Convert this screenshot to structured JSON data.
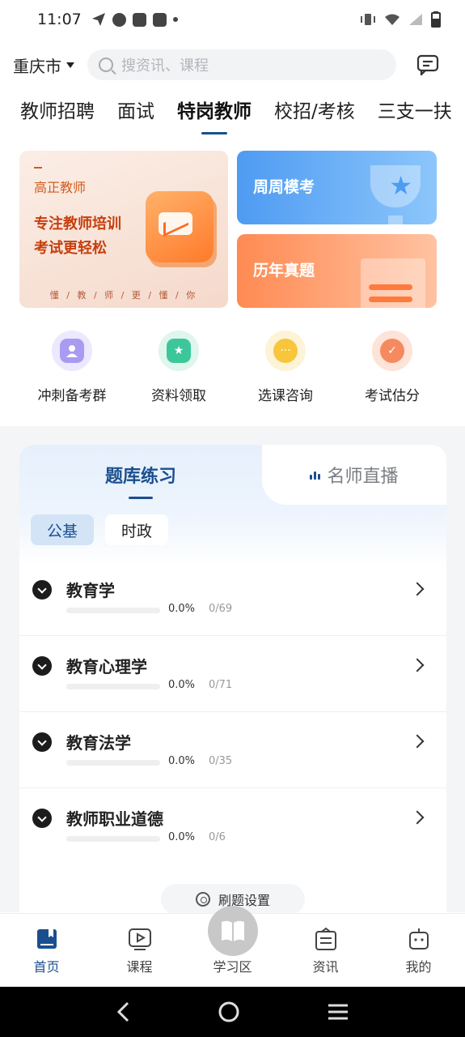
{
  "status_bar": {
    "time": "11:07"
  },
  "header": {
    "city": "重庆市",
    "search_placeholder": "搜资讯、课程"
  },
  "categories": [
    {
      "label": "教师招聘"
    },
    {
      "label": "面试"
    },
    {
      "label": "特岗教师"
    },
    {
      "label": "校招/考核"
    },
    {
      "label": "三支一扶"
    }
  ],
  "banners": {
    "main": {
      "brand": "高正教师",
      "line1": "专注教师培训",
      "line2": "考试更轻松",
      "tagline": "懂 / 教 / 师 / 更 / 懂 / 你"
    },
    "weekly": {
      "title": "周周模考"
    },
    "past": {
      "title": "历年真题"
    }
  },
  "quick_actions": [
    {
      "label": "冲刺备考群",
      "color": "#a99af2",
      "bg": "#ece8fd"
    },
    {
      "label": "资料领取",
      "color": "#3cc79a",
      "bg": "#def6ec"
    },
    {
      "label": "选课咨询",
      "color": "#f7c63c",
      "bg": "#fdf3d6"
    },
    {
      "label": "考试估分",
      "color": "#f58a60",
      "bg": "#fde3d8"
    }
  ],
  "practice": {
    "tab_active": "题库练习",
    "tab_inactive": "名师直播",
    "chips": [
      "公基",
      "时政"
    ],
    "subjects": [
      {
        "name": "教育学",
        "pct": "0.0%",
        "count": "0/69",
        "progress": 0
      },
      {
        "name": "教育心理学",
        "pct": "0.0%",
        "count": "0/71",
        "progress": 0
      },
      {
        "name": "教育法学",
        "pct": "0.0%",
        "count": "0/35",
        "progress": 0
      },
      {
        "name": "教师职业道德",
        "pct": "0.0%",
        "count": "0/6",
        "progress": 0
      }
    ],
    "settings_label": "刷题设置"
  },
  "bottom_nav": [
    {
      "label": "首页"
    },
    {
      "label": "课程"
    },
    {
      "label": "学习区"
    },
    {
      "label": "资讯"
    },
    {
      "label": "我的"
    }
  ],
  "colors": {
    "accent": "#1a4f8f",
    "banner_orange": "#ff8a52",
    "banner_blue": "#4e9bf2"
  }
}
